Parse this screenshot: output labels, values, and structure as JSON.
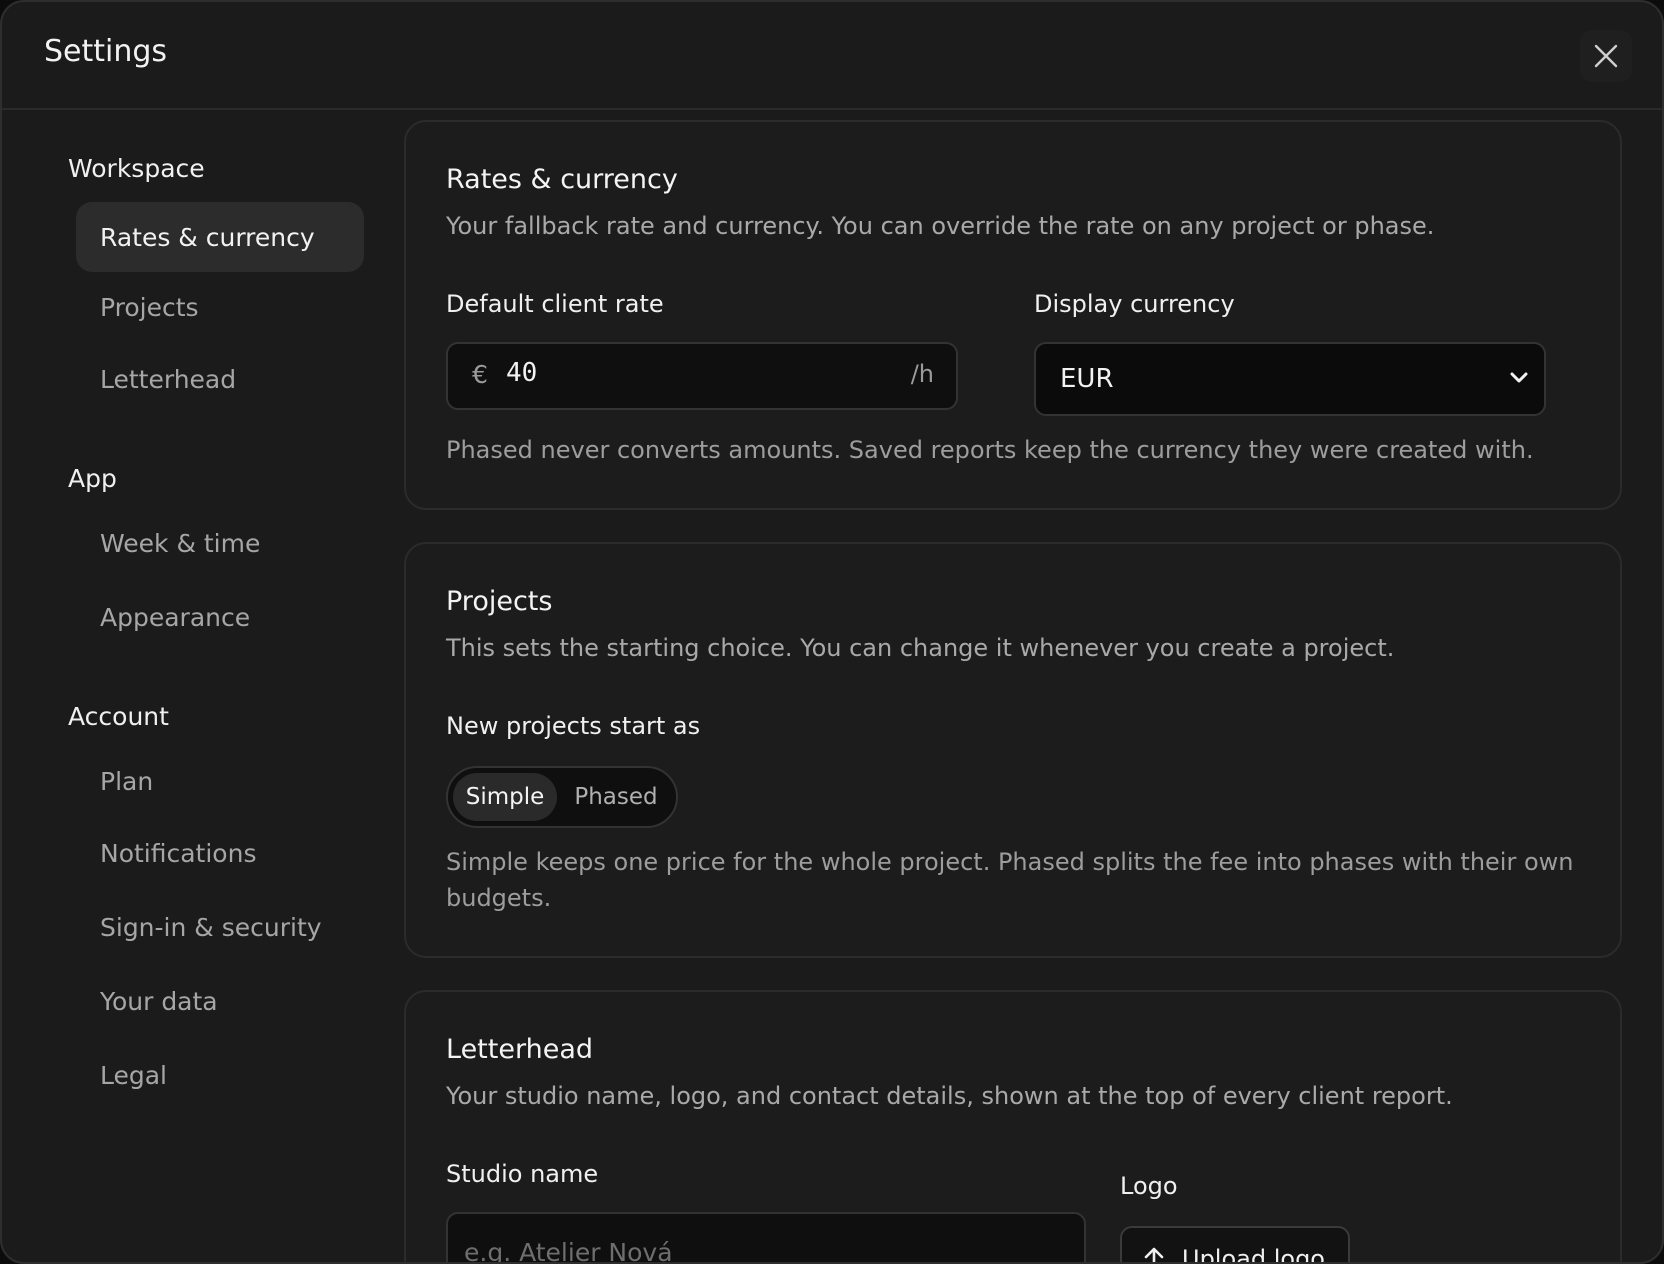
{
  "window": {
    "title": "Settings"
  },
  "sidebar": {
    "groups": [
      {
        "title": "Workspace",
        "items": [
          "Rates & currency",
          "Projects",
          "Letterhead"
        ]
      },
      {
        "title": "App",
        "items": [
          "Week & time",
          "Appearance"
        ]
      },
      {
        "title": "Account",
        "items": [
          "Plan",
          "Notifications",
          "Sign-in & security",
          "Your data",
          "Legal"
        ]
      }
    ],
    "active_item": "Rates & currency"
  },
  "rates": {
    "title": "Rates & currency",
    "description": "Your fallback rate and currency. You can override the rate on any project or phase.",
    "rate_label": "Default client rate",
    "rate_symbol": "€",
    "rate_value": "40",
    "rate_unit": "/h",
    "currency_label": "Display currency",
    "currency_value": "EUR",
    "help": "Phased never converts amounts. Saved reports keep the currency they were created with."
  },
  "projects": {
    "title": "Projects",
    "description": "This sets the starting choice. You can change it whenever you create a project.",
    "field_label": "New projects start as",
    "options": [
      "Simple",
      "Phased"
    ],
    "selected": "Simple",
    "help": "Simple keeps one price for the whole project. Phased splits the fee into phases with their own budgets."
  },
  "letterhead": {
    "title": "Letterhead",
    "description": "Your studio name, logo, and contact details, shown at the top of every client report.",
    "studio_label": "Studio name",
    "studio_placeholder": "e.g. Atelier Nová",
    "logo_label": "Logo",
    "upload_label": "Upload logo"
  }
}
